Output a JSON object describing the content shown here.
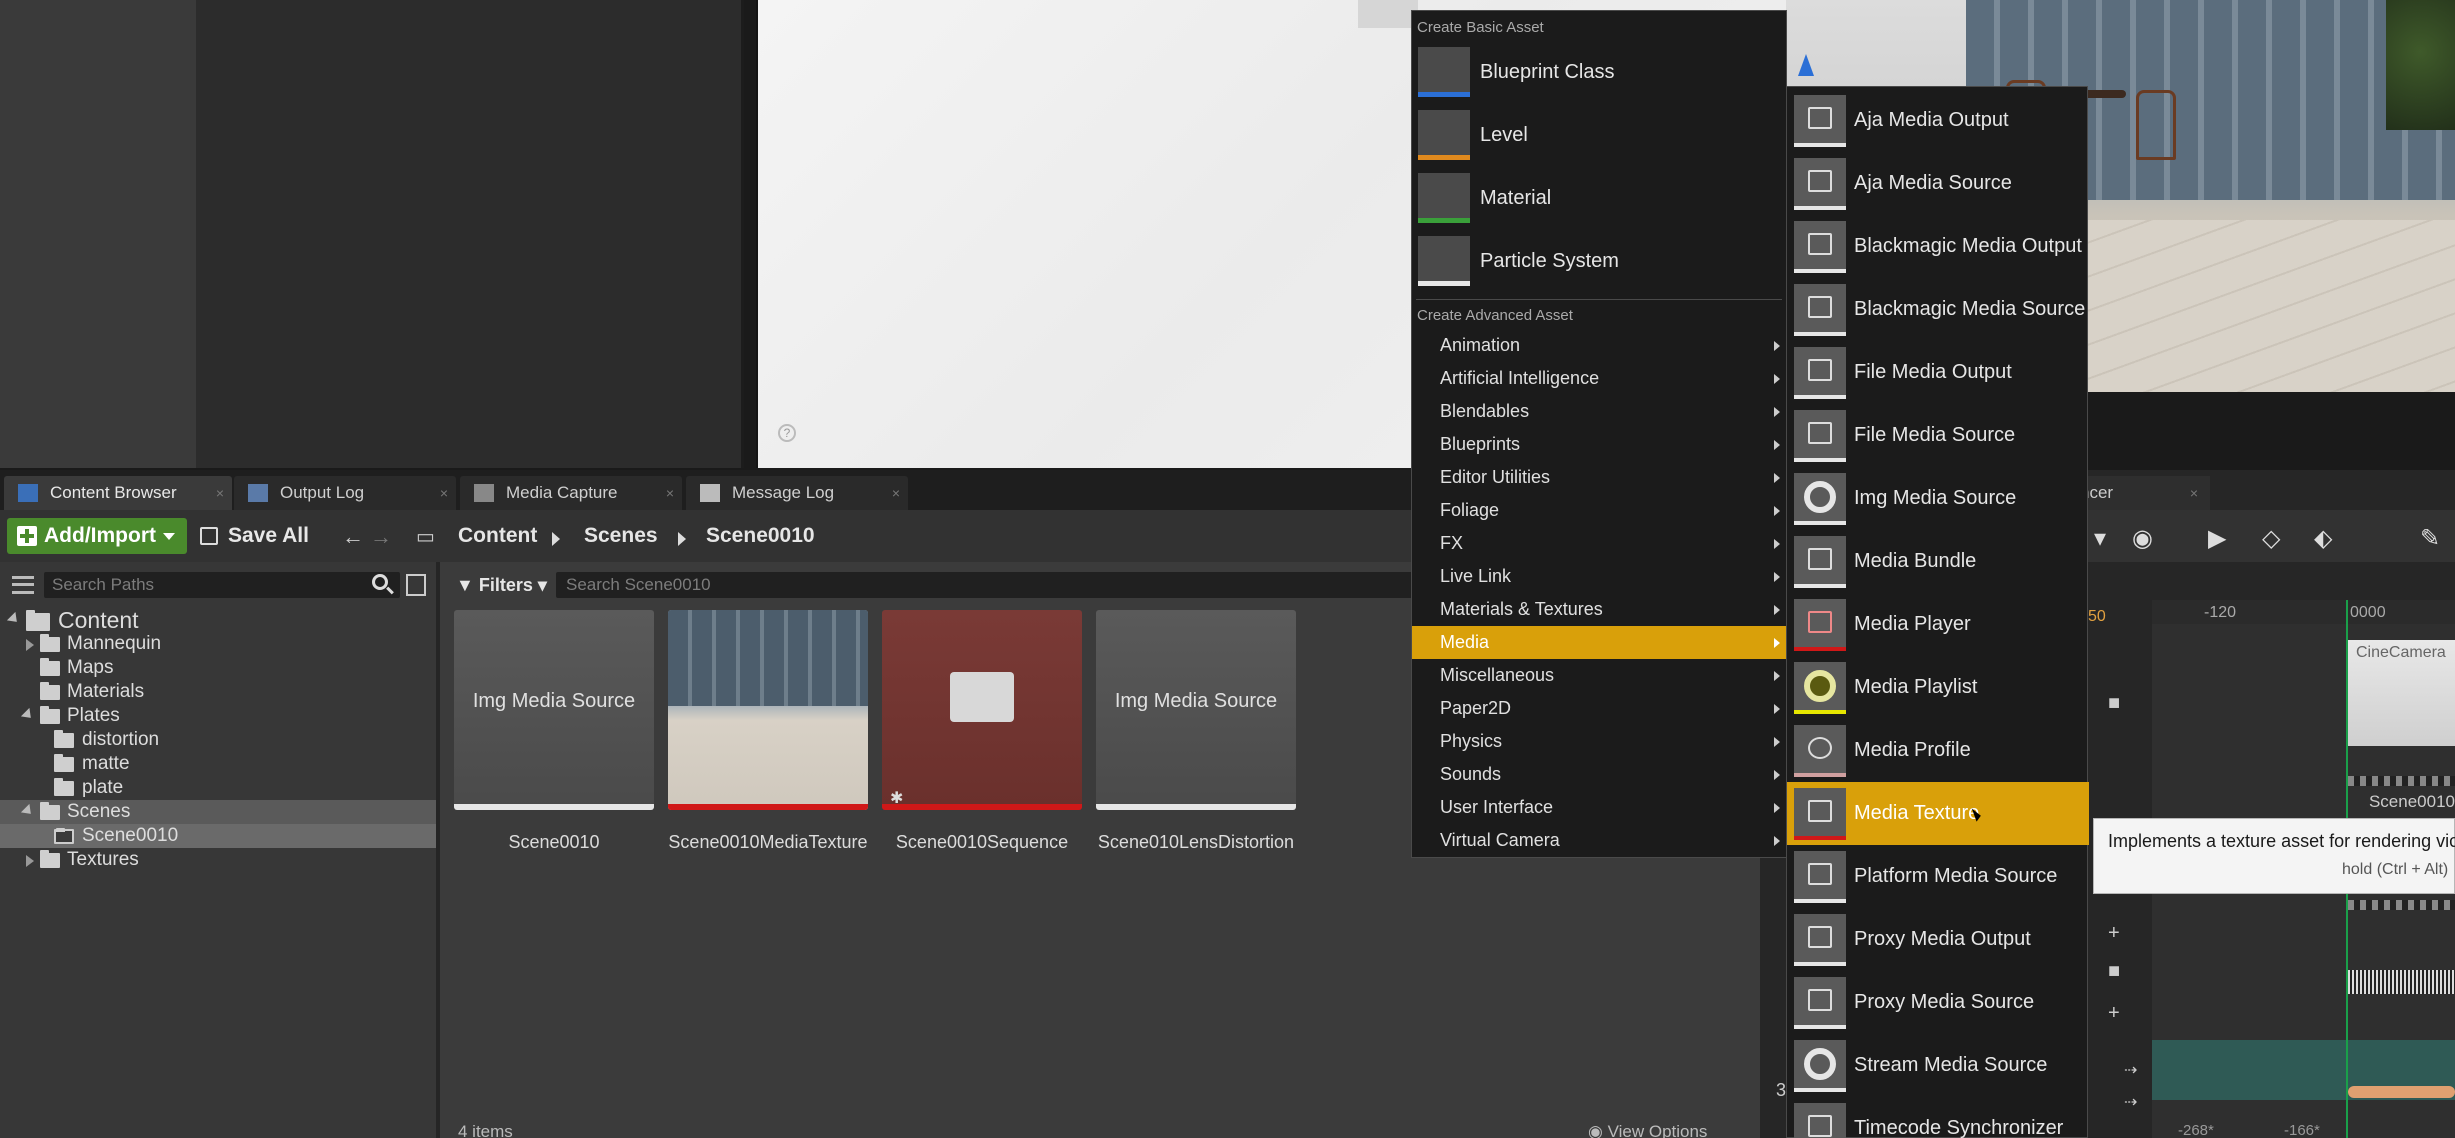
{
  "tabs": [
    {
      "label": "Content Browser",
      "icon": "content-browser-icon"
    },
    {
      "label": "Output Log",
      "icon": "output-log-icon"
    },
    {
      "label": "Media Capture",
      "icon": "media-capture-icon"
    },
    {
      "label": "Message Log",
      "icon": "message-log-icon"
    }
  ],
  "toolbar": {
    "add_import": "Add/Import",
    "save_all": "Save All",
    "breadcrumb": [
      "Content",
      "Scenes",
      "Scene0010"
    ]
  },
  "tree": {
    "search_placeholder": "Search Paths",
    "items": [
      {
        "label": "Content",
        "level": 0,
        "expanded": true
      },
      {
        "label": "Mannequin",
        "level": 1,
        "expanded": false
      },
      {
        "label": "Maps",
        "level": 1
      },
      {
        "label": "Materials",
        "level": 1
      },
      {
        "label": "Plates",
        "level": 1,
        "expanded": true
      },
      {
        "label": "distortion",
        "level": 2
      },
      {
        "label": "matte",
        "level": 2
      },
      {
        "label": "plate",
        "level": 2
      },
      {
        "label": "Scenes",
        "level": 1,
        "expanded": true
      },
      {
        "label": "Scene0010",
        "level": 2,
        "selected": true
      },
      {
        "label": "Textures",
        "level": 1,
        "expanded": false
      }
    ]
  },
  "assets": {
    "filters_label": "Filters",
    "search_placeholder": "Search Scene0010",
    "items": [
      {
        "name": "Scene0010",
        "thumb_label": "Img Media Source",
        "bar_color": "#e6e6e6"
      },
      {
        "name": "Scene0010MediaTexture",
        "thumb_label": "",
        "bar_color": "#d01818"
      },
      {
        "name": "Scene0010Sequence",
        "thumb_label": "",
        "bar_color": "#d01818"
      },
      {
        "name": "Scene010LensDistortion",
        "thumb_label": "Img Media Source",
        "bar_color": "#e6e6e6"
      }
    ],
    "item_count": "4 items",
    "view_options": "View Options"
  },
  "menu": {
    "basic_header": "Create Basic Asset",
    "basic_items": [
      {
        "label": "Blueprint Class",
        "bar": "#2b6fd6"
      },
      {
        "label": "Level",
        "bar": "#e08a1e"
      },
      {
        "label": "Material",
        "bar": "#3aa03a"
      },
      {
        "label": "Particle System",
        "bar": "#e6e6e6"
      }
    ],
    "advanced_header": "Create Advanced Asset",
    "advanced_items": [
      "Animation",
      "Artificial Intelligence",
      "Blendables",
      "Blueprints",
      "Editor Utilities",
      "Foliage",
      "FX",
      "Live Link",
      "Materials & Textures",
      "Media",
      "Miscellaneous",
      "Paper2D",
      "Physics",
      "Sounds",
      "User Interface",
      "Virtual Camera"
    ],
    "highlighted": "Media"
  },
  "submenu": {
    "items": [
      {
        "label": "Aja Media Output",
        "bar": "#e6e6e6"
      },
      {
        "label": "Aja Media Source",
        "bar": "#e6e6e6"
      },
      {
        "label": "Blackmagic Media Output",
        "bar": "#e6e6e6"
      },
      {
        "label": "Blackmagic Media Source",
        "bar": "#e6e6e6"
      },
      {
        "label": "File Media Output",
        "bar": "#e6e6e6"
      },
      {
        "label": "File Media Source",
        "bar": "#e6e6e6"
      },
      {
        "label": "Img Media Source",
        "bar": "#e6e6e6"
      },
      {
        "label": "Media Bundle",
        "bar": "#e6e6e6"
      },
      {
        "label": "Media Player",
        "bar": "#d01818"
      },
      {
        "label": "Media Playlist",
        "bar": "#e6e600"
      },
      {
        "label": "Media Profile",
        "bar": "#d0a0a0"
      },
      {
        "label": "Media Texture",
        "bar": "#d01818"
      },
      {
        "label": "Platform Media Source",
        "bar": "#e6e6e6"
      },
      {
        "label": "Proxy Media Output",
        "bar": "#e6e6e6"
      },
      {
        "label": "Proxy Media Source",
        "bar": "#e6e6e6"
      },
      {
        "label": "Stream Media Source",
        "bar": "#e6e6e6"
      },
      {
        "label": "Timecode Synchronizer",
        "bar": "#e6e6e6"
      }
    ],
    "highlighted": "Media Texture"
  },
  "tooltip": {
    "text": "Implements a texture asset for rendering vic",
    "hint": "hold (Ctrl + Alt)"
  },
  "sequencer": {
    "tab_fragment": "ncer",
    "time_highlight": "50",
    "ticks": [
      "-120",
      "0000"
    ],
    "camera_label": "CineCamera",
    "track_label": "Scene0010",
    "bottom_ticks": [
      "-268*",
      "-166*"
    ],
    "side_digit": "3"
  }
}
